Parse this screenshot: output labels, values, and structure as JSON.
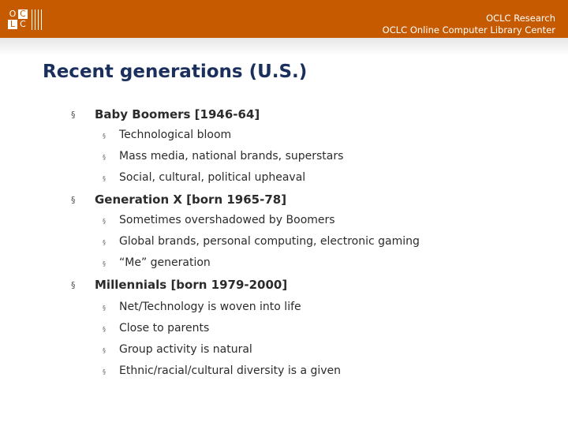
{
  "header": {
    "logo": {
      "letters": [
        "O",
        "C",
        "L",
        "C"
      ],
      "label": "OCLC"
    },
    "org_line1": "OCLC Research",
    "org_line2": "OCLC Online Computer Library Center",
    "bar_color": "#c65a00"
  },
  "slide": {
    "title": "Recent generations (U.S.)",
    "title_color": "#1a2f5c",
    "bullet_glyph": "§",
    "sections": [
      {
        "heading": "Baby Boomers [1946-64]",
        "items": [
          "Technological bloom",
          "Mass media, national brands, superstars",
          "Social, cultural, political upheaval"
        ]
      },
      {
        "heading": "Generation X [born 1965-78]",
        "items": [
          "Sometimes overshadowed by Boomers",
          "Global brands, personal computing, electronic gaming",
          "“Me” generation"
        ]
      },
      {
        "heading": "Millennials [born 1979-2000]",
        "items": [
          "Net/Technology is woven into life",
          "Close to parents",
          "Group activity is natural",
          "Ethnic/racial/cultural diversity is a given"
        ]
      }
    ]
  }
}
